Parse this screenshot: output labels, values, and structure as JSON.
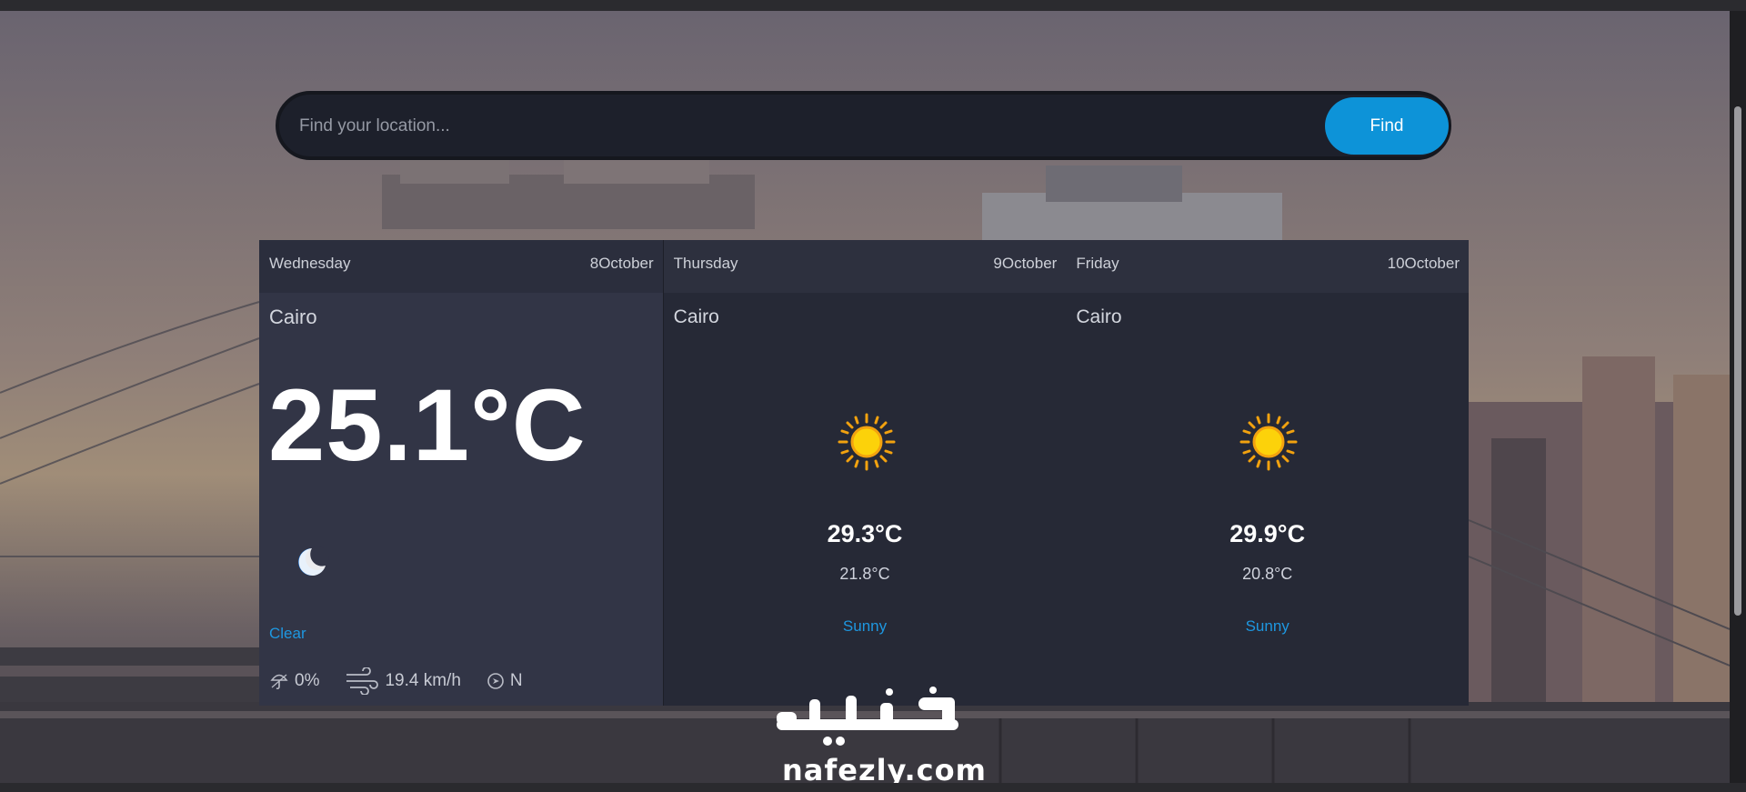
{
  "search": {
    "placeholder": "Find your location...",
    "value": "",
    "button_label": "Find"
  },
  "forecast": [
    {
      "day": "Wednesday",
      "date": "8October",
      "city": "Cairo",
      "temp": "25.1°C",
      "icon": "moon-icon",
      "condition": "Clear",
      "rain": "0%",
      "wind": "19.4 km/h",
      "direction": "N"
    },
    {
      "day": "Thursday",
      "date": "9October",
      "city": "Cairo",
      "icon": "sun-icon",
      "max_temp": "29.3°C",
      "min_temp": "21.8°C",
      "condition": "Sunny"
    },
    {
      "day": "Friday",
      "date": "10October",
      "city": "Cairo",
      "icon": "sun-icon",
      "max_temp": "29.9°C",
      "min_temp": "20.8°C",
      "condition": "Sunny"
    }
  ],
  "watermark": {
    "arabic": "نفذلي",
    "url": "nafezly.com"
  },
  "colors": {
    "accent": "#0d93d8",
    "condition_text": "#1e97e0",
    "card": "#262936",
    "card_today": "#323546"
  }
}
